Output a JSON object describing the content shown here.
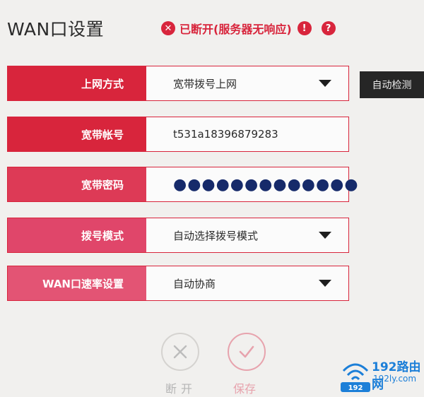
{
  "header": {
    "title": "WAN口设置",
    "status": "已断开(服务器无响应)"
  },
  "form": {
    "rows": [
      {
        "label": "上网方式",
        "value": "宽带拨号上网"
      },
      {
        "label": "宽带帐号",
        "value": "t531a18396879283"
      },
      {
        "label": "宽带密码",
        "value": "●●●●●●●●●●●●●"
      },
      {
        "label": "拨号模式",
        "value": "自动选择拨号模式"
      },
      {
        "label": "WAN口速率设置",
        "value": "自动协商"
      }
    ],
    "auto_detect_label": "自动检测"
  },
  "actions": {
    "disconnect_label": "断开",
    "save_label": "保存"
  },
  "watermark": {
    "brand": "192路由网",
    "site": "192ly.com",
    "badge": "192"
  },
  "colors": {
    "accent": "#d8253c",
    "save_pink": "#e7a3ad",
    "watermark_blue": "#1c7fd8"
  }
}
